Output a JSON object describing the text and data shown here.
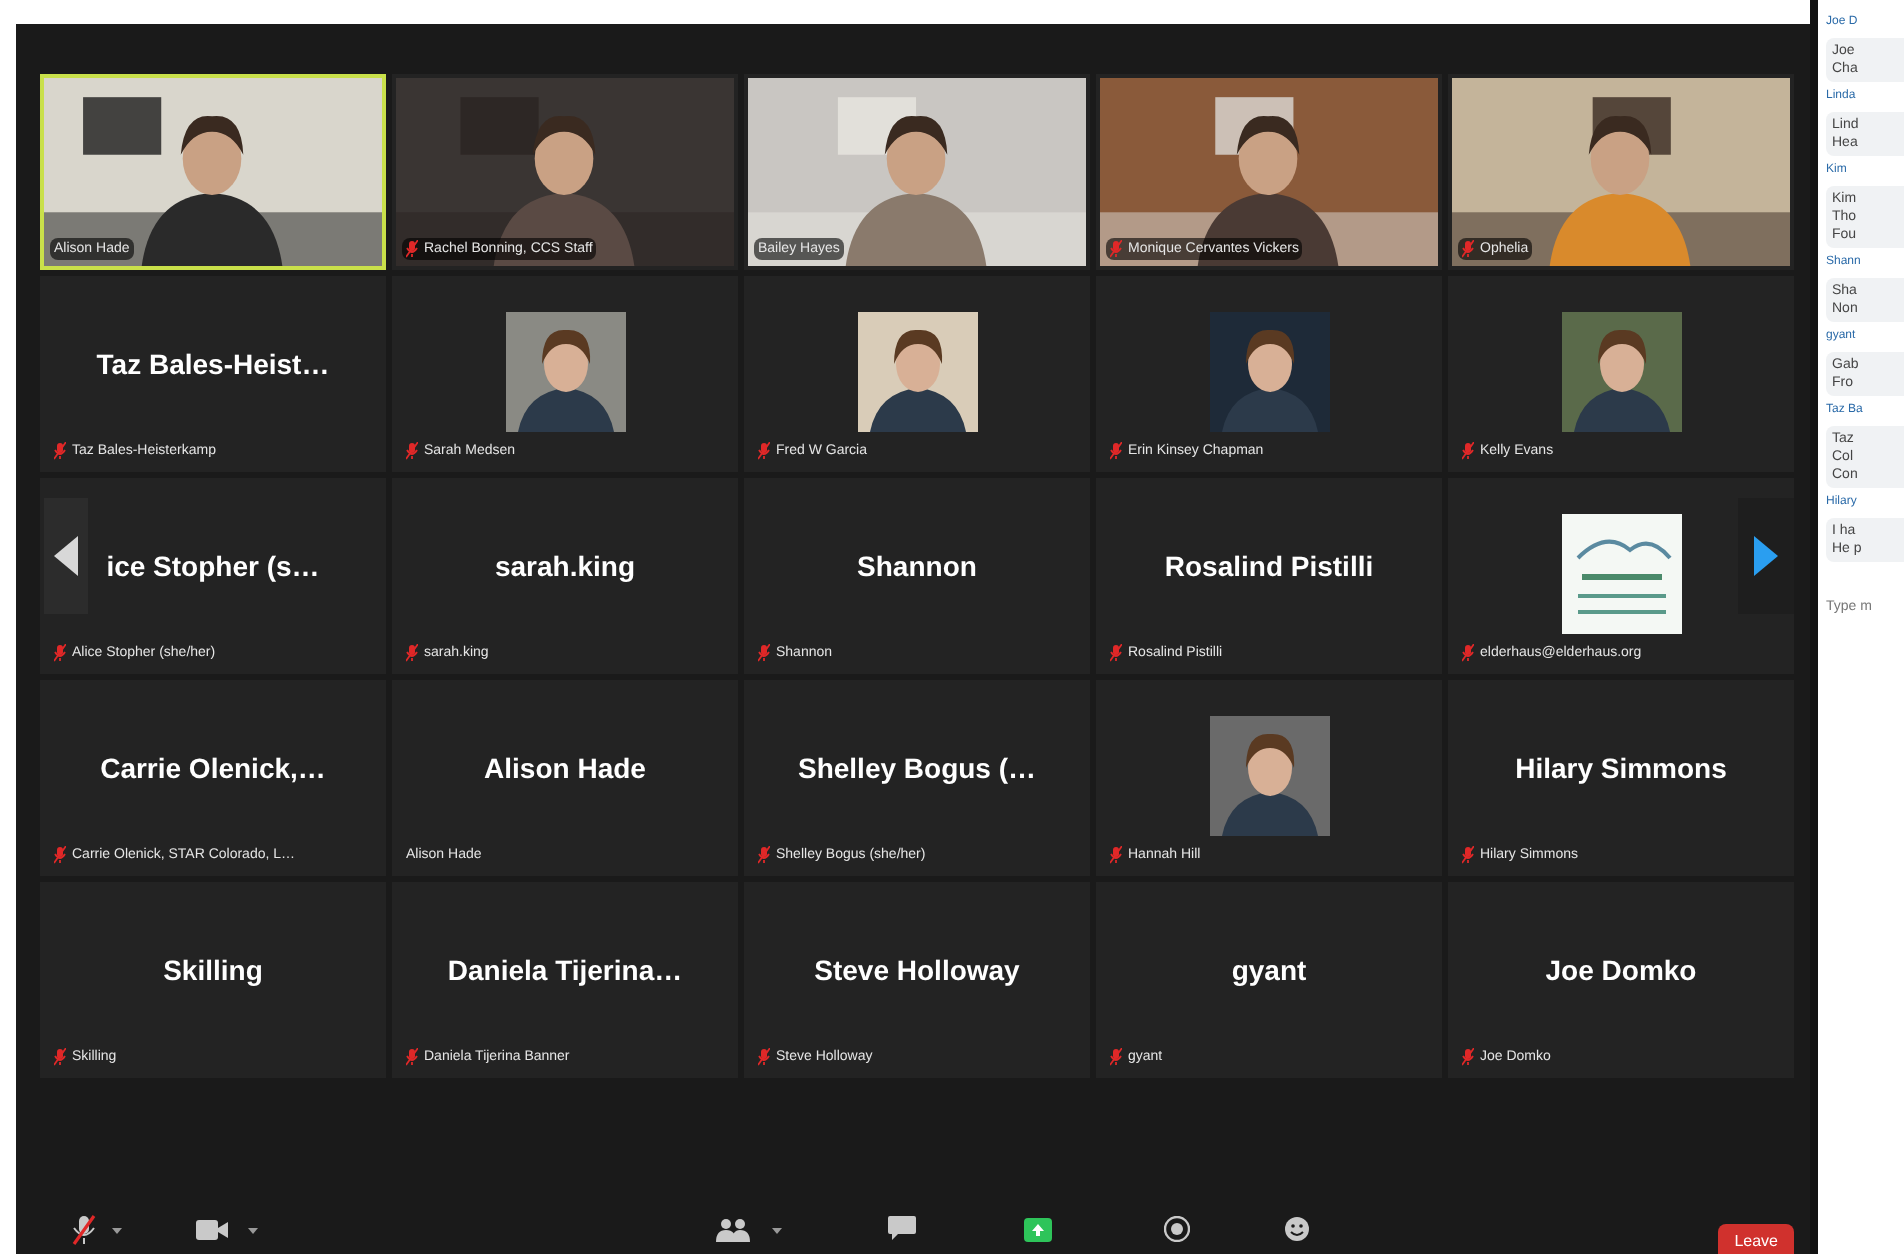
{
  "tiles": [
    {
      "kind": "video",
      "label": "Alison Hade",
      "muted": false,
      "speaking": true
    },
    {
      "kind": "video",
      "label": "Rachel Bonning, CCS Staff",
      "muted": true,
      "speaking": false
    },
    {
      "kind": "video",
      "label": "Bailey Hayes",
      "muted": false,
      "speaking": false
    },
    {
      "kind": "video",
      "label": "Monique Cervantes Vickers",
      "muted": true,
      "speaking": false
    },
    {
      "kind": "video",
      "label": "Ophelia",
      "muted": true,
      "speaking": false
    },
    {
      "kind": "name",
      "name": "Taz Bales-Heist…",
      "label": "Taz Bales-Heisterkamp",
      "muted": true,
      "speaking": false
    },
    {
      "label": "Sarah Medsen",
      "muted": true,
      "speaking": false
    },
    {
      "label": "Fred W Garcia",
      "muted": true,
      "speaking": false
    },
    {
      "label": "Erin Kinsey Chapman",
      "muted": true,
      "speaking": false
    },
    {
      "label": "Kelly Evans",
      "muted": true,
      "speaking": false
    },
    {
      "kind": "name",
      "name": "ice Stopher (s…",
      "label": "Alice Stopher (she/her)",
      "muted": true,
      "speaking": false
    },
    {
      "kind": "name",
      "name": "sarah.king",
      "label": "sarah.king",
      "muted": true,
      "speaking": false
    },
    {
      "kind": "name",
      "name": "Shannon",
      "label": "Shannon",
      "muted": true,
      "speaking": false
    },
    {
      "kind": "name",
      "name": "Rosalind Pistilli",
      "label": "Rosalind Pistilli",
      "muted": true,
      "speaking": false
    },
    {
      "label": "elderhaus@elderhaus.org",
      "muted": true,
      "speaking": false
    },
    {
      "kind": "name",
      "name": "Carrie Olenick,…",
      "label": "Carrie Olenick, STAR Colorado, L…",
      "muted": true,
      "speaking": false
    },
    {
      "kind": "name",
      "name": "Alison Hade",
      "label": "Alison Hade",
      "muted": false,
      "speaking": false
    },
    {
      "kind": "name",
      "name": "Shelley Bogus (…",
      "label": "Shelley Bogus (she/her)",
      "muted": true,
      "speaking": false
    },
    {
      "label": "Hannah Hill",
      "muted": true,
      "speaking": false
    },
    {
      "kind": "name",
      "name": "Hilary Simmons",
      "label": "Hilary Simmons",
      "muted": true,
      "speaking": false
    },
    {
      "kind": "name",
      "name": "Skilling",
      "label": "Skilling",
      "muted": true,
      "speaking": false
    },
    {
      "kind": "name",
      "name": "Daniela Tijerina…",
      "label": "Daniela Tijerina Banner",
      "muted": true,
      "speaking": false
    },
    {
      "kind": "name",
      "name": "Steve Holloway",
      "label": "Steve Holloway",
      "muted": true,
      "speaking": false
    },
    {
      "kind": "name",
      "name": "gyant",
      "label": "gyant",
      "muted": true,
      "speaking": false
    },
    {
      "kind": "name",
      "name": "Joe Domko",
      "label": "Joe Domko",
      "muted": true,
      "speaking": false
    }
  ],
  "toolbar": {
    "mic_muted": true,
    "leave": "Leave"
  },
  "chat": {
    "messages": [
      {
        "sender": "Joe D",
        "lines": [
          "Joe",
          "Cha"
        ]
      },
      {
        "sender": "Linda",
        "lines": [
          "Lind",
          "Hea"
        ]
      },
      {
        "sender": "Kim",
        "lines": [
          "Kim",
          "Tho",
          "Fou"
        ]
      },
      {
        "sender": "Shann",
        "lines": [
          "Sha",
          "Non"
        ]
      },
      {
        "sender": "gyant",
        "lines": [
          "Gab",
          "Fro"
        ]
      },
      {
        "sender": "Taz Ba",
        "lines": [
          "Taz",
          "Col",
          "Con"
        ]
      },
      {
        "sender": "Hilary",
        "lines": [
          "I ha",
          "He p"
        ]
      }
    ],
    "placeholder": "Type m"
  }
}
